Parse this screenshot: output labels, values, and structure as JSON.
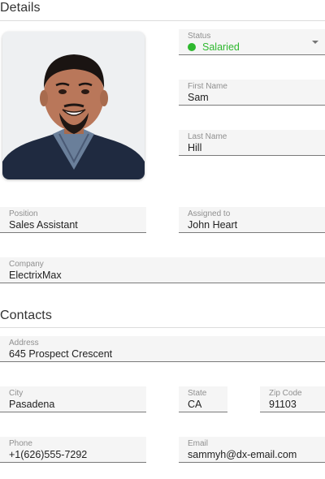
{
  "details": {
    "section_title": "Details",
    "status": {
      "label": "Status",
      "value": "Salaried",
      "color": "#2eb82e"
    },
    "first_name": {
      "label": "First Name",
      "value": "Sam"
    },
    "last_name": {
      "label": "Last Name",
      "value": "Hill"
    },
    "position": {
      "label": "Position",
      "value": "Sales Assistant"
    },
    "assigned_to": {
      "label": "Assigned to",
      "value": "John Heart"
    },
    "company": {
      "label": "Company",
      "value": "ElectrixMax"
    }
  },
  "contacts": {
    "section_title": "Contacts",
    "address": {
      "label": "Address",
      "value": "645 Prospect Crescent"
    },
    "city": {
      "label": "City",
      "value": "Pasadena"
    },
    "state": {
      "label": "State",
      "value": "CA"
    },
    "zip": {
      "label": "Zip Code",
      "value": "91103"
    },
    "phone": {
      "label": "Phone",
      "value": "+1(626)555-7292"
    },
    "email": {
      "label": "Email",
      "value": "sammyh@dx-email.com"
    }
  }
}
